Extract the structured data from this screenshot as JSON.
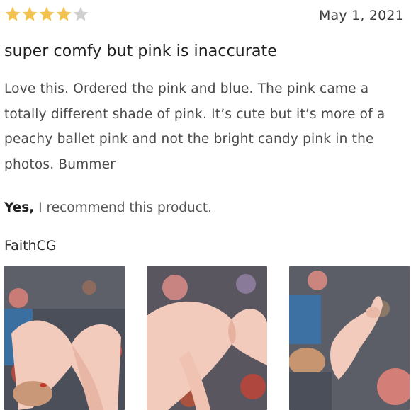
{
  "review": {
    "rating": 4,
    "max_rating": 5,
    "date": "May 1, 2021",
    "title": "super comfy but pink is inaccurate",
    "body": "Love this. Ordered the pink and blue. The pink came a totally different shade of pink. It’s cute but it’s more of a peachy ballet pink and not the bright candy pink in the photos. Bummer",
    "recommend_yes": "Yes,",
    "recommend_text": " I recommend this product.",
    "author": "FaithCG",
    "photo_count": 3
  },
  "colors": {
    "star_filled": "#f2c14e",
    "star_empty": "#cfcfcf",
    "headband_pink": "#f2cbbd"
  },
  "icons": {
    "star": "star-icon"
  }
}
